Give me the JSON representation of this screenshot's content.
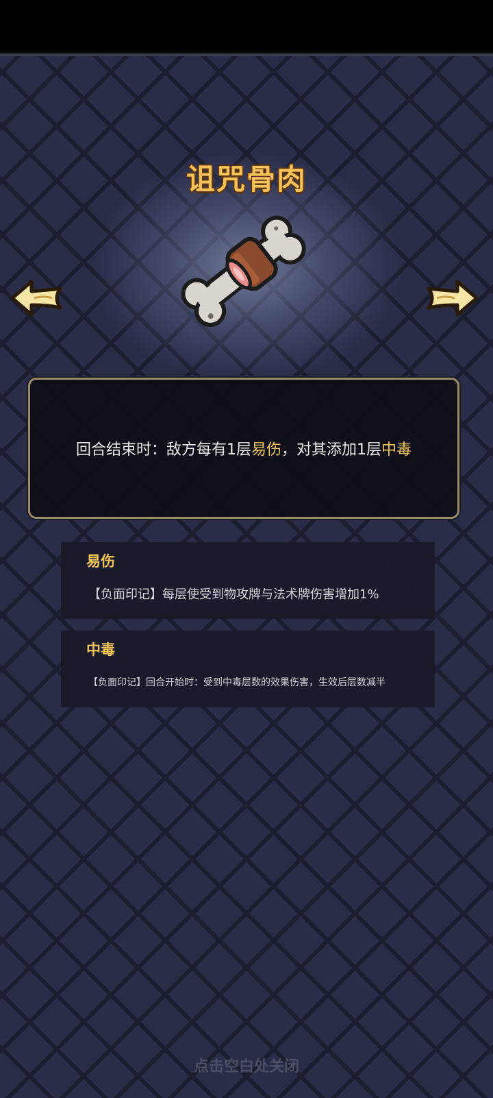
{
  "item": {
    "name": "诅咒骨肉",
    "icon": "cursed-bone-meat-icon",
    "description_parts": [
      "回合结束时：敌方每有1层",
      "易伤",
      "，对其添加1层",
      "中毒"
    ]
  },
  "keywords": [
    {
      "title": "易伤",
      "description": "【负面印记】每层使受到物攻牌与法术牌伤害增加1%"
    },
    {
      "title": "中毒",
      "description": "【负面印记】回合开始时：受到中毒层数的效果伤害，生效后层数减半"
    }
  ],
  "footer": {
    "close_hint": "点击空白处关闭"
  },
  "icons": {
    "prev": "arrow-left-icon",
    "next": "arrow-right-icon"
  },
  "colors": {
    "accent": "#f2c55b",
    "title": "#f5c15a",
    "background": "#272a45"
  }
}
